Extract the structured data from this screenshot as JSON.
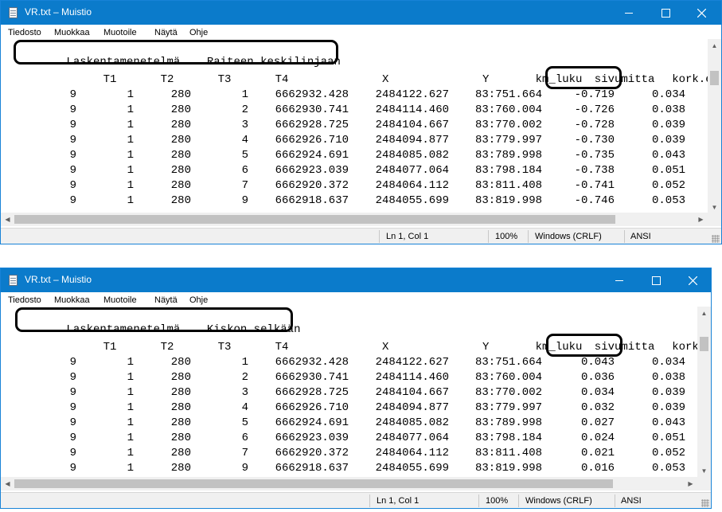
{
  "windows": [
    {
      "title": "VR.txt – Muistio",
      "menu": [
        "Tiedosto",
        "Muokkaa",
        "Muotoile",
        "Näytä",
        "Ohje"
      ],
      "method_label": "Laskentamenetelmä",
      "method_value": "Raiteen keskilinjaan",
      "headers": [
        "T1",
        "T2",
        "T3",
        "T4",
        "X",
        "Y",
        "km_luku",
        "sivumitta",
        "kork.ero"
      ],
      "rows": [
        [
          "9",
          "1",
          "280",
          "1",
          "6662932.428",
          "2484122.627",
          "83:751.664",
          "-0.719",
          "0.034"
        ],
        [
          "9",
          "1",
          "280",
          "2",
          "6662930.741",
          "2484114.460",
          "83:760.004",
          "-0.726",
          "0.038"
        ],
        [
          "9",
          "1",
          "280",
          "3",
          "6662928.725",
          "2484104.667",
          "83:770.002",
          "-0.728",
          "0.039"
        ],
        [
          "9",
          "1",
          "280",
          "4",
          "6662926.710",
          "2484094.877",
          "83:779.997",
          "-0.730",
          "0.039"
        ],
        [
          "9",
          "1",
          "280",
          "5",
          "6662924.691",
          "2484085.082",
          "83:789.998",
          "-0.735",
          "0.043"
        ],
        [
          "9",
          "1",
          "280",
          "6",
          "6662923.039",
          "2484077.064",
          "83:798.184",
          "-0.738",
          "0.051"
        ],
        [
          "9",
          "1",
          "280",
          "7",
          "6662920.372",
          "2484064.112",
          "83:811.408",
          "-0.741",
          "0.052"
        ],
        [
          "9",
          "1",
          "280",
          "9",
          "6662918.637",
          "2484055.699",
          "83:819.998",
          "-0.746",
          "0.053"
        ]
      ],
      "status": {
        "position": "Ln 1, Col 1",
        "zoom": "100%",
        "line_ending": "Windows (CRLF)",
        "encoding": "ANSI"
      }
    },
    {
      "title": "VR.txt – Muistio",
      "menu": [
        "Tiedosto",
        "Muokkaa",
        "Muotoile",
        "Näytä",
        "Ohje"
      ],
      "method_label": "Laskentamenetelmä",
      "method_value": "Kiskon selkään",
      "headers": [
        "T1",
        "T2",
        "T3",
        "T4",
        "X",
        "Y",
        "km_luku",
        "sivumitta",
        "kork.ero"
      ],
      "rows": [
        [
          "9",
          "1",
          "280",
          "1",
          "6662932.428",
          "2484122.627",
          "83:751.664",
          "0.043",
          "0.034"
        ],
        [
          "9",
          "1",
          "280",
          "2",
          "6662930.741",
          "2484114.460",
          "83:760.004",
          "0.036",
          "0.038"
        ],
        [
          "9",
          "1",
          "280",
          "3",
          "6662928.725",
          "2484104.667",
          "83:770.002",
          "0.034",
          "0.039"
        ],
        [
          "9",
          "1",
          "280",
          "4",
          "6662926.710",
          "2484094.877",
          "83:779.997",
          "0.032",
          "0.039"
        ],
        [
          "9",
          "1",
          "280",
          "5",
          "6662924.691",
          "2484085.082",
          "83:789.998",
          "0.027",
          "0.043"
        ],
        [
          "9",
          "1",
          "280",
          "6",
          "6662923.039",
          "2484077.064",
          "83:798.184",
          "0.024",
          "0.051"
        ],
        [
          "9",
          "1",
          "280",
          "7",
          "6662920.372",
          "2484064.112",
          "83:811.408",
          "0.021",
          "0.052"
        ],
        [
          "9",
          "1",
          "280",
          "9",
          "6662918.637",
          "2484055.699",
          "83:819.998",
          "0.016",
          "0.053"
        ]
      ],
      "status": {
        "position": "Ln 1, Col 1",
        "zoom": "100%",
        "line_ending": "Windows (CRLF)",
        "encoding": "ANSI"
      }
    }
  ],
  "colors": {
    "titlebar": "#0b7bcb",
    "callout": "#000000"
  },
  "icons": {
    "app": "notepad-icon",
    "minimize": "minimize-icon",
    "maximize": "maximize-icon",
    "close": "close-icon",
    "scroll_up": "arrow-up-icon",
    "scroll_down": "arrow-down-icon",
    "scroll_left": "arrow-left-icon",
    "scroll_right": "arrow-right-icon"
  }
}
